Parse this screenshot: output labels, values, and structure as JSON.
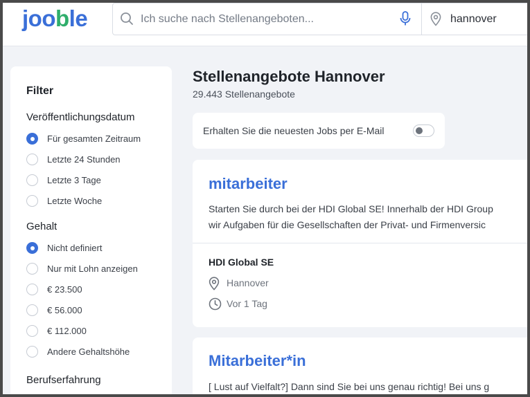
{
  "header": {
    "logo": {
      "prefix": "joo",
      "mark": "b",
      "suffix": "le"
    },
    "search_placeholder": "Ich suche nach Stellenangeboten...",
    "location_value": "hannover"
  },
  "sidebar": {
    "title": "Filter",
    "date_section": {
      "title": "Veröffentlichungsdatum",
      "options": [
        {
          "label": "Für gesamten Zeitraum",
          "selected": true
        },
        {
          "label": "Letzte 24 Stunden",
          "selected": false
        },
        {
          "label": "Letzte 3 Tage",
          "selected": false
        },
        {
          "label": "Letzte Woche",
          "selected": false
        }
      ]
    },
    "salary_section": {
      "title": "Gehalt",
      "options": [
        {
          "label": "Nicht definiert",
          "selected": true
        },
        {
          "label": "Nur mit Lohn anzeigen",
          "selected": false
        },
        {
          "label": "€ 23.500",
          "selected": false
        },
        {
          "label": "€ 56.000",
          "selected": false
        },
        {
          "label": "€ 112.000",
          "selected": false
        },
        {
          "label": "Andere Gehaltshöhe",
          "selected": false
        }
      ]
    },
    "experience_section": {
      "title": "Berufserfahrung"
    }
  },
  "main": {
    "title": "Stellenangebote Hannover",
    "count": "29.443 Stellenangebote",
    "email_alert": {
      "label": "Erhalten Sie die neuesten Jobs per E-Mail",
      "enabled": false
    },
    "jobs": [
      {
        "title": "mitarbeiter",
        "desc_line1": "Starten Sie durch bei der HDI Global SE! Innerhalb der HDI Group",
        "desc_line2": "wir Aufgaben für die Gesellschaften der Privat- und Firmenversic",
        "company": "HDI Global SE",
        "location": "Hannover",
        "posted": "Vor 1 Tag"
      },
      {
        "title": "Mitarbeiter*in",
        "desc_line1": "[ Lust auf Vielfalt?] Dann sind Sie bei uns genau richtig! Bei uns g"
      }
    ]
  },
  "colors": {
    "accent": "#3a6fd8",
    "logo_green": "#2fae6b"
  }
}
